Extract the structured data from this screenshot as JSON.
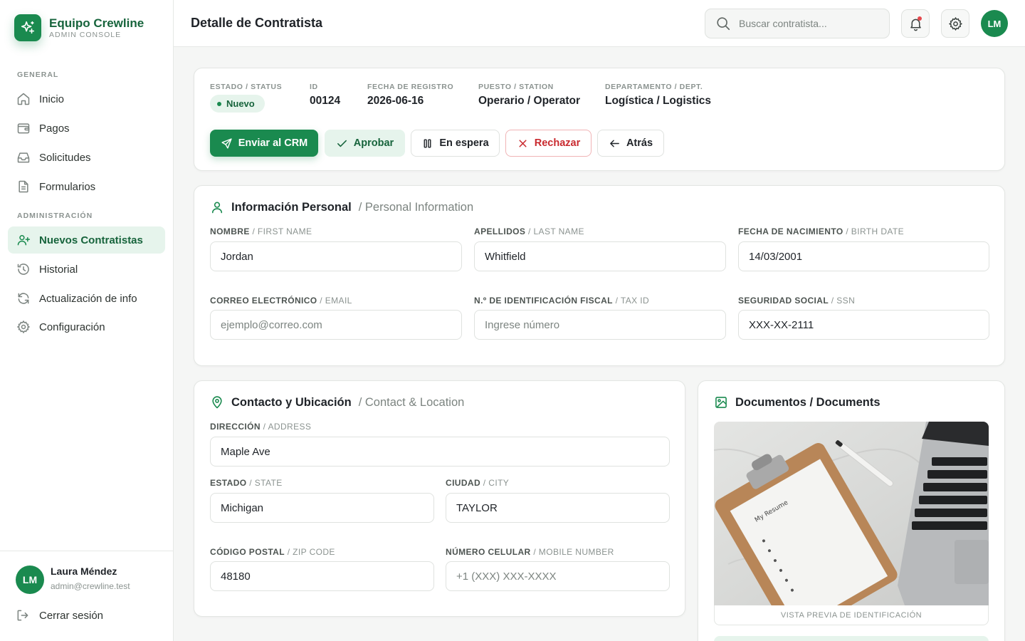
{
  "brand": {
    "name": "Equipo Crewline",
    "subtitle": "ADMIN CONSOLE",
    "icon": "sparkles-icon",
    "accent": "#1a8a4f"
  },
  "sidebar": {
    "sections": [
      {
        "label": "GENERAL"
      },
      {
        "label": "ADMINISTRACIÓN"
      }
    ],
    "items": [
      {
        "label": "Inicio",
        "icon": "home-icon"
      },
      {
        "label": "Pagos",
        "icon": "wallet-icon"
      },
      {
        "label": "Solicitudes",
        "icon": "inbox-icon"
      },
      {
        "label": "Formularios",
        "icon": "document-icon"
      },
      {
        "label": "Nuevos Contratistas",
        "icon": "user-plus-icon",
        "active": true
      },
      {
        "label": "Historial",
        "icon": "history-icon"
      },
      {
        "label": "Actualización de info",
        "icon": "refresh-icon"
      },
      {
        "label": "Configuración",
        "icon": "gear-icon"
      }
    ],
    "user": {
      "initials": "LM",
      "name": "Laura Méndez",
      "email": "admin@crewline.test"
    },
    "logout_label": "Cerrar sesión"
  },
  "header": {
    "title": "Detalle de Contratista",
    "search_placeholder": "Buscar contratista...",
    "avatar_initials": "LM"
  },
  "summary": {
    "status": {
      "label": "ESTADO / STATUS",
      "value": "Nuevo"
    },
    "id": {
      "label": "ID",
      "value": "00124"
    },
    "date": {
      "label": "FECHA DE REGISTRO",
      "value": "2026-06-16"
    },
    "station": {
      "label": "PUESTO / STATION",
      "value": "Operario / Operator"
    },
    "dept": {
      "label": "DEPARTAMENTO / DEPT.",
      "value": "Logística / Logistics"
    },
    "actions": {
      "send_crm": "Enviar al CRM",
      "approve": "Aprobar",
      "on_hold": "En espera",
      "reject": "Rechazar",
      "back": "Atrás"
    }
  },
  "personal": {
    "title": "Información Personal",
    "subtitle": "/ Personal Information",
    "fields": {
      "first_name": {
        "label_es": "NOMBRE",
        "label_en": " / FIRST NAME",
        "value": "Jordan"
      },
      "last_name": {
        "label_es": "APELLIDOS",
        "label_en": " / LAST NAME",
        "value": "Whitfield"
      },
      "birth_date": {
        "label_es": "FECHA DE NACIMIENTO",
        "label_en": " / BIRTH DATE",
        "value": "14/03/2001"
      },
      "email": {
        "label_es": "CORREO ELECTRÓNICO",
        "label_en": " / EMAIL",
        "value": "",
        "placeholder": "ejemplo@correo.com"
      },
      "tax_id": {
        "label_es": "N.º DE IDENTIFICACIÓN FISCAL",
        "label_en": " / TAX ID",
        "value": "",
        "placeholder": "Ingrese número"
      },
      "ssn": {
        "label_es": "SEGURIDAD SOCIAL",
        "label_en": " / SSN",
        "value": "XXX-XX-2111"
      }
    }
  },
  "contact": {
    "title": "Contacto y Ubicación",
    "subtitle": "/ Contact & Location",
    "fields": {
      "address": {
        "label_es": "DIRECCIÓN",
        "label_en": " / ADDRESS",
        "value": "Maple Ave"
      },
      "state": {
        "label_es": "ESTADO",
        "label_en": " / STATE",
        "value": "Michigan"
      },
      "city": {
        "label_es": "CIUDAD",
        "label_en": " / CITY",
        "value": "TAYLOR"
      },
      "zip": {
        "label_es": "CÓDIGO POSTAL",
        "label_en": " / ZIP CODE",
        "value": "48180"
      },
      "mobile": {
        "label_es": "NÚMERO CELULAR",
        "label_en": " / MOBILE NUMBER",
        "value": "",
        "placeholder": "+1 (XXX) XXX-XXXX"
      }
    }
  },
  "documents": {
    "title": "Documentos / Documents",
    "resume_text": "My Resume",
    "caption": "VISTA PREVIA DE IDENTIFICACIÓN"
  }
}
